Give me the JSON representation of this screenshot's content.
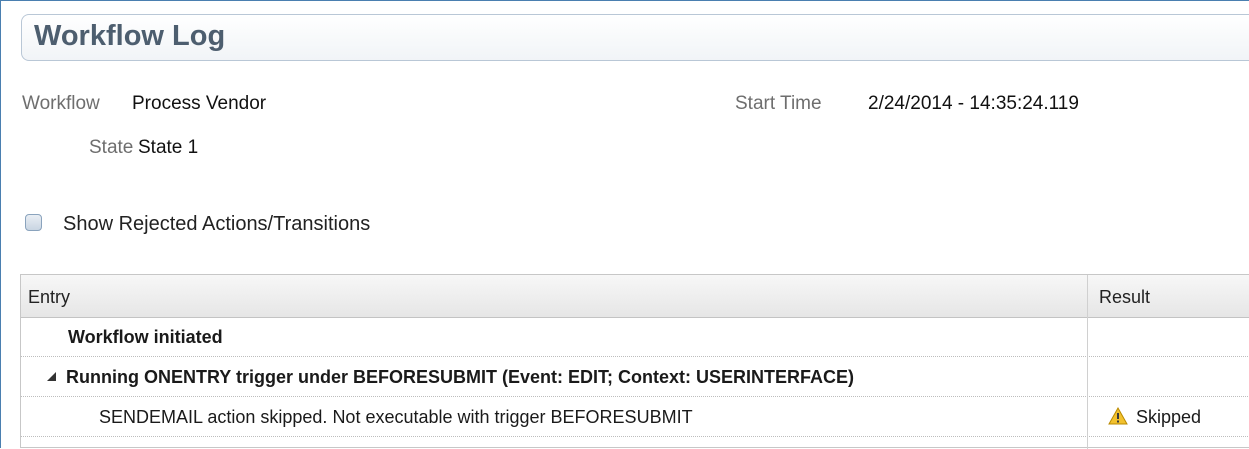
{
  "page": {
    "title": "Workflow Log"
  },
  "details": {
    "workflow_label": "Workflow",
    "workflow_value": "Process Vendor",
    "state_label": "State",
    "state_value": "State 1",
    "start_time_label": "Start Time",
    "start_time_value": "2/24/2014 - 14:35:24.119"
  },
  "options": {
    "show_rejected_label": "Show Rejected Actions/Transitions",
    "show_rejected_checked": false
  },
  "grid": {
    "columns": [
      "Entry",
      "Result"
    ],
    "rows": [
      {
        "entry": "Workflow initiated",
        "result": "",
        "bold": true,
        "expander": false
      },
      {
        "entry": "Running ONENTRY trigger under BEFORESUBMIT (Event: EDIT; Context: USERINTERFACE)",
        "result": "",
        "bold": true,
        "expander": true
      },
      {
        "entry": "SENDEMAIL action skipped. Not executable with trigger BEFORESUBMIT",
        "result": "Skipped",
        "bold": false,
        "expander": false,
        "result_icon": "warning-icon"
      }
    ]
  },
  "colors": {
    "title": "#4d5e6f",
    "frame": "#4a7fb0",
    "warning": "#f2c12e"
  }
}
